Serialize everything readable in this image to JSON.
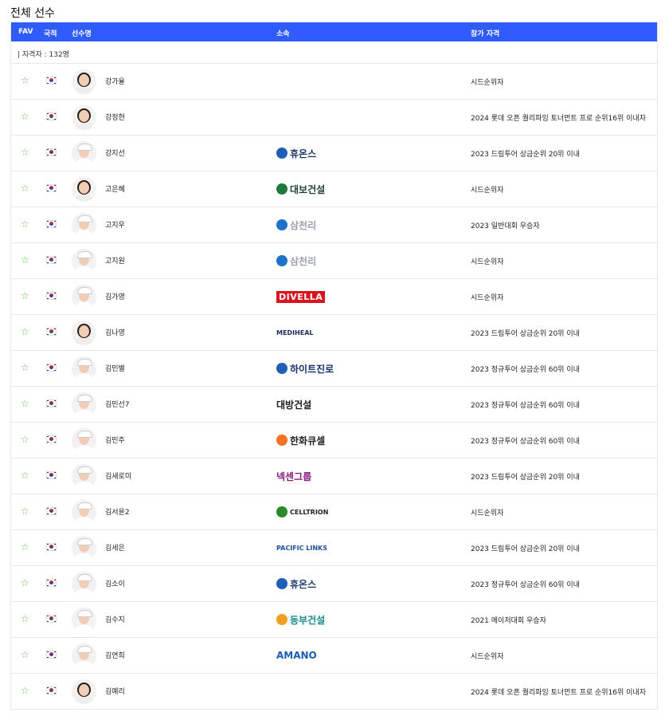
{
  "page_title": "전체 선수",
  "header": {
    "fav": "FAV",
    "nation": "국적",
    "name": "선수명",
    "affiliation": "소속",
    "qualification": "참가 자격"
  },
  "count_text": "| 자격자 : 132명",
  "players": [
    {
      "name": "강가율",
      "sponsor": "",
      "qualification": "시드순위자",
      "look": "hair"
    },
    {
      "name": "강정현",
      "sponsor": "",
      "qualification": "2024 롯데 오픈 퀄리파잉 토너먼트 프로 순위16위 이내자",
      "look": "hair"
    },
    {
      "name": "강지선",
      "sponsor": "휴온스",
      "qualification": "2023 드림투어 상금순위 20위 이내",
      "look": "cap"
    },
    {
      "name": "고은혜",
      "sponsor": "대보건설",
      "qualification": "시드순위자",
      "look": "hair"
    },
    {
      "name": "고지우",
      "sponsor": "삼천리",
      "qualification": "2023 일반대회 우승자",
      "look": "cap"
    },
    {
      "name": "고지원",
      "sponsor": "삼천리",
      "qualification": "시드순위자",
      "look": "cap"
    },
    {
      "name": "김가영",
      "sponsor": "DIVELLA",
      "qualification": "시드순위자",
      "look": "cap"
    },
    {
      "name": "김나영",
      "sponsor": "MEDIHEAL",
      "qualification": "2023 드림투어 상금순위 20위 이내",
      "look": "hair"
    },
    {
      "name": "김민별",
      "sponsor": "하이트진로",
      "qualification": "2023 정규투어 상금순위 60위 이내",
      "look": "cap"
    },
    {
      "name": "김민선7",
      "sponsor": "대방건설",
      "qualification": "2023 정규투어 상금순위 60위 이내",
      "look": "cap"
    },
    {
      "name": "김민주",
      "sponsor": "한화큐셀",
      "qualification": "2023 정규투어 상금순위 60위 이내",
      "look": "cap"
    },
    {
      "name": "김새로미",
      "sponsor": "넥센그룹",
      "qualification": "2023 드림투어 상금순위 20위 이내",
      "look": "cap"
    },
    {
      "name": "김서윤2",
      "sponsor": "CELLTRION",
      "qualification": "시드순위자",
      "look": "cap"
    },
    {
      "name": "김세은",
      "sponsor": "PACIFIC LINKS",
      "qualification": "2023 드림투어 상금순위 20위 이내",
      "look": "cap"
    },
    {
      "name": "김소이",
      "sponsor": "휴온스",
      "qualification": "2023 정규투어 상금순위 60위 이내",
      "look": "cap"
    },
    {
      "name": "김수지",
      "sponsor": "동부건설",
      "qualification": "2021 메이저대회 우승자",
      "look": "cap"
    },
    {
      "name": "김연희",
      "sponsor": "AMANO",
      "qualification": "시드순위자",
      "look": "cap"
    },
    {
      "name": "김예리",
      "sponsor": "",
      "qualification": "2024 롯데 오픈 퀄리파잉 토너먼트 프로 순위16위 이내자",
      "look": "hair"
    }
  ],
  "sponsor_styles": {
    "휴온스": {
      "color": "#1d3a6e",
      "icon_color": "#1f5fb8",
      "icon_text": "hu"
    },
    "대보건설": {
      "color": "#1f4730",
      "icon_color": "#1d7a3a",
      "icon_text": ""
    },
    "삼천리": {
      "color": "#9aa3ad",
      "icon_color": "#1e73c8",
      "icon_text": ""
    },
    "DIVELLA": {
      "color": "#ffffff",
      "bg": "#d8141e"
    },
    "MEDIHEAL": {
      "color": "#1c2c5e"
    },
    "하이트진로": {
      "color": "#14306d",
      "icon_color": "#1f5fb8"
    },
    "대방건설": {
      "color": "#1a1a1a"
    },
    "한화큐셀": {
      "color": "#222",
      "icon_color": "#f37321"
    },
    "넥센그룹": {
      "color": "#8a1b7e"
    },
    "CELLTRION": {
      "color": "#222",
      "icon_color": "#2a8a2a"
    },
    "PACIFIC LINKS": {
      "color": "#1f4f9c"
    },
    "동부건설": {
      "color": "#158a8a",
      "icon_color": "#f0a020"
    },
    "AMANO": {
      "color": "#1b5bb0"
    }
  }
}
